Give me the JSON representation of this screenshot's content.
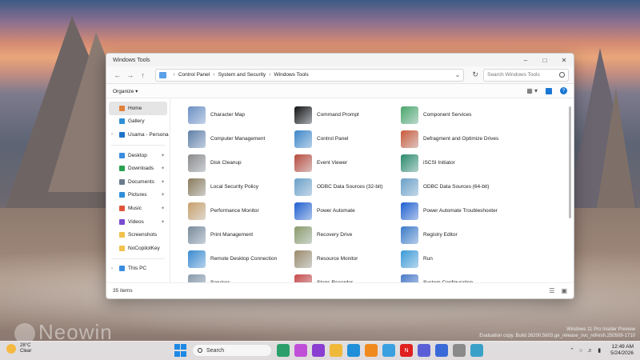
{
  "window": {
    "title": "Windows Tools",
    "breadcrumbs": [
      "Control Panel",
      "System and Security",
      "Windows Tools"
    ],
    "search_placeholder": "Search Windows Tools",
    "organize_label": "Organize",
    "status_count": "35 items"
  },
  "sidebar": {
    "items": [
      {
        "label": "Home",
        "icon": "home-icon",
        "color": "#e0803a",
        "active": true
      },
      {
        "label": "Gallery",
        "icon": "gallery-icon",
        "color": "#2f8fd8"
      },
      {
        "label": "Usama - Persona",
        "icon": "cloud-icon",
        "color": "#1f74c9",
        "caret": true
      },
      {
        "label": "Desktop",
        "icon": "desktop-icon",
        "color": "#3a8de0",
        "pin": true
      },
      {
        "label": "Downloads",
        "icon": "download-icon",
        "color": "#2aa050",
        "pin": true
      },
      {
        "label": "Documents",
        "icon": "documents-icon",
        "color": "#6b7b8c",
        "pin": true
      },
      {
        "label": "Pictures",
        "icon": "pictures-icon",
        "color": "#2f8fd8",
        "pin": true
      },
      {
        "label": "Music",
        "icon": "music-icon",
        "color": "#e0553a",
        "pin": true
      },
      {
        "label": "Videos",
        "icon": "videos-icon",
        "color": "#7a4bd0",
        "pin": true
      },
      {
        "label": "Screenshots",
        "icon": "folder-icon",
        "color": "#f2c14e"
      },
      {
        "label": "NoCopilotKey",
        "icon": "folder-icon",
        "color": "#f2c14e"
      },
      {
        "label": "This PC",
        "icon": "pc-icon",
        "color": "#3a8de0",
        "caret": true
      }
    ]
  },
  "tools": [
    {
      "label": "Character Map",
      "icon": "character-map-icon",
      "color": "#6c8fc4"
    },
    {
      "label": "Command Prompt",
      "icon": "command-prompt-icon",
      "color": "#111111"
    },
    {
      "label": "Component Services",
      "icon": "component-services-icon",
      "color": "#4aa66a"
    },
    {
      "label": "Computer Management",
      "icon": "computer-management-icon",
      "color": "#5f7fa8"
    },
    {
      "label": "Control Panel",
      "icon": "control-panel-icon",
      "color": "#3b86c9"
    },
    {
      "label": "Defragment and Optimize Drives",
      "icon": "defragment-icon",
      "color": "#c85a3a"
    },
    {
      "label": "Disk Cleanup",
      "icon": "disk-cleanup-icon",
      "color": "#8a8a8a"
    },
    {
      "label": "Event Viewer",
      "icon": "event-viewer-icon",
      "color": "#b84a3a"
    },
    {
      "label": "iSCSI Initiator",
      "icon": "iscsi-icon",
      "color": "#2a8a6a"
    },
    {
      "label": "Local Security Policy",
      "icon": "security-policy-icon",
      "color": "#8a7a5a"
    },
    {
      "label": "ODBC Data Sources (32-bit)",
      "icon": "odbc32-icon",
      "color": "#6aa0c8"
    },
    {
      "label": "ODBC Data Sources (64-bit)",
      "icon": "odbc64-icon",
      "color": "#6aa0c8"
    },
    {
      "label": "Performance Monitor",
      "icon": "performance-monitor-icon",
      "color": "#c8a06a"
    },
    {
      "label": "Power Automate",
      "icon": "power-automate-icon",
      "color": "#1f5fd0"
    },
    {
      "label": "Power Automate Troubleshooter",
      "icon": "power-automate-troubleshooter-icon",
      "color": "#1f5fd0"
    },
    {
      "label": "Print Management",
      "icon": "print-management-icon",
      "color": "#7a8a9a"
    },
    {
      "label": "Recovery Drive",
      "icon": "recovery-drive-icon",
      "color": "#8a9a6a"
    },
    {
      "label": "Registry Editor",
      "icon": "registry-editor-icon",
      "color": "#3a7ac8"
    },
    {
      "label": "Remote Desktop Connection",
      "icon": "remote-desktop-icon",
      "color": "#3a8ad0"
    },
    {
      "label": "Resource Monitor",
      "icon": "resource-monitor-icon",
      "color": "#9a8a6a"
    },
    {
      "label": "Run",
      "icon": "run-icon",
      "color": "#3a9ad8"
    },
    {
      "label": "Services",
      "icon": "services-icon",
      "color": "#8a9aaa"
    },
    {
      "label": "Steps Recorder",
      "icon": "steps-recorder-icon",
      "color": "#c84a4a"
    },
    {
      "label": "System Configuration",
      "icon": "system-configuration-icon",
      "color": "#4a7ac8"
    }
  ],
  "taskbar": {
    "weather_temp": "28°C",
    "weather_text": "Clear",
    "search_label": "Search",
    "time": "12:49 AM",
    "date": "5/24/2026"
  },
  "desktop": {
    "watermark": "Neowin",
    "build_line1": "Windows 11 Pro Insider Preview",
    "build_line2": "Evaluation copy. Build 26200.5603.ge_release_svc_refresh.250509-1710"
  }
}
